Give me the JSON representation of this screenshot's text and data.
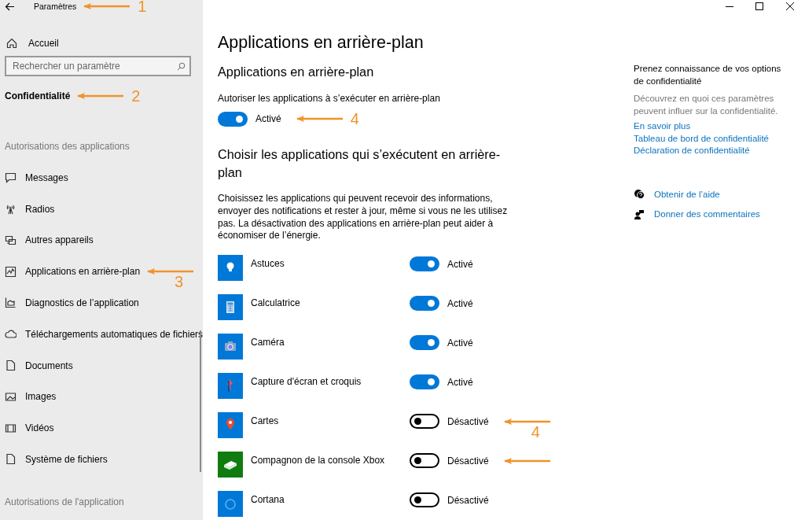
{
  "window": {
    "title": "Paramètres",
    "arrow": true,
    "number": "1"
  },
  "sidebar": {
    "home": "Accueil",
    "search": {
      "placeholder": "Rechercher un paramètre"
    },
    "category": {
      "label": "Confidentialité",
      "arrow": true,
      "number": "2"
    },
    "sections": [
      {
        "heading": "Autorisations des applications",
        "items": [
          {
            "label": "Messages",
            "arrow": false
          },
          {
            "label": "Radios",
            "arrow": false
          },
          {
            "label": "Autres appareils",
            "arrow": false
          },
          {
            "label": "Applications en arrière-plan",
            "arrow": true,
            "number": "3"
          },
          {
            "label": "Diagnostics de l’application",
            "arrow": false
          },
          {
            "label": "Téléchargements automatiques de fichiers",
            "arrow": false
          },
          {
            "label": "Documents",
            "arrow": false
          },
          {
            "label": "Images",
            "arrow": false
          },
          {
            "label": "Vidéos",
            "arrow": false
          },
          {
            "label": "Système de fichiers",
            "arrow": false
          }
        ]
      },
      {
        "heading": "Autorisations de l'application"
      }
    ]
  },
  "main": {
    "title": "Applications en arrière-plan",
    "section1": {
      "title": "Applications en arrière-plan",
      "label": "Autoriser les applications à s’exécuter en arrière-plan",
      "toggle": {
        "on": true,
        "state_text": "Activé",
        "arrow": true,
        "number": "4"
      }
    },
    "section2": {
      "title": "Choisir les applications qui s’exécutent en arrière-plan",
      "description": "Choisissez les applications qui peuvent recevoir des informations, envoyer des notifications et rester à jour, même si vous ne les utilisez pas. La désactivation des applications en arrière-plan peut aider à économiser de l’énergie.",
      "apps": [
        {
          "name": "Astuces",
          "color": "#0078d7",
          "on": true,
          "state_text": "Activé",
          "arrow": false
        },
        {
          "name": "Calculatrice",
          "color": "#0078d7",
          "on": true,
          "state_text": "Activé",
          "arrow": false
        },
        {
          "name": "Caméra",
          "color": "#0078d7",
          "on": true,
          "state_text": "Activé",
          "arrow": false
        },
        {
          "name": "Capture d'écran et croquis",
          "color": "#0078d7",
          "on": true,
          "state_text": "Activé",
          "arrow": false
        },
        {
          "name": "Cartes",
          "color": "#0078d7",
          "on": false,
          "state_text": "Désactivé",
          "arrow": true,
          "number": "4"
        },
        {
          "name": "Compagnon de la console Xbox",
          "color": "#107c10",
          "on": false,
          "state_text": "Désactivé",
          "arrow": true
        },
        {
          "name": "Cortana",
          "color": "#0078d7",
          "on": false,
          "state_text": "Désactivé",
          "arrow": false
        }
      ]
    }
  },
  "help": {
    "heading": "Prenez connaissance de vos options de confidentialité",
    "description": "Découvrez en quoi ces paramètres peuvent influer sur la confidentialité.",
    "links": [
      "En savoir plus",
      "Tableau de bord de confidentialité",
      "Déclaration de confidentialité"
    ],
    "actions": [
      "Obtenir de l’aide",
      "Donner des commentaires"
    ]
  }
}
